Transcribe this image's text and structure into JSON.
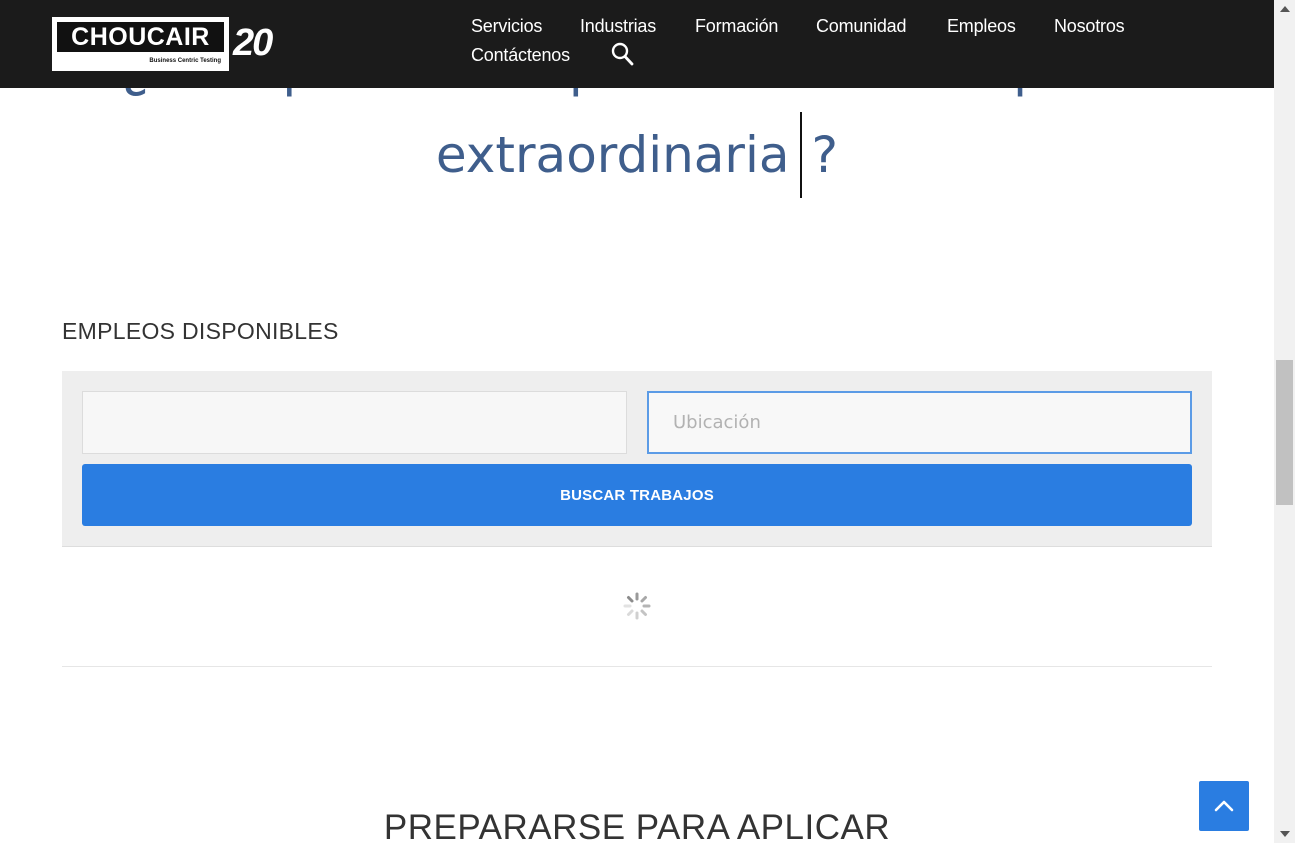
{
  "hero": {
    "line1": "¿Listo para hacer parte de una compañía",
    "line2_word": "extraordinaria",
    "line2_end": "?"
  },
  "header": {
    "logo": {
      "brand": "CHOUCAIR",
      "tagline": "Business Centric Testing",
      "anniversary": "20"
    },
    "nav": [
      {
        "label": "Servicios"
      },
      {
        "label": "Industrias"
      },
      {
        "label": "Formación"
      },
      {
        "label": "Comunidad"
      },
      {
        "label": "Empleos"
      },
      {
        "label": "Nosotros"
      },
      {
        "label": "Contáctenos"
      }
    ],
    "search_icon": "search-icon"
  },
  "jobs": {
    "title": "EMPLEOS DISPONIBLES",
    "keyword": {
      "value": "",
      "placeholder": ""
    },
    "location": {
      "value": "",
      "placeholder": "Ubicación"
    },
    "search_button": "BUSCAR TRABAJOS",
    "loading_icon": "spinner-icon"
  },
  "prepare": {
    "title": "PREPARARSE PARA APLICAR"
  },
  "back_to_top_icon": "chevron-up-icon",
  "colors": {
    "header_bg": "#1b1b1b",
    "hero_text": "#3f5e8c",
    "accent": "#2a7de1",
    "panel_bg": "#eeeeee",
    "focus_border": "#5b9be6"
  }
}
